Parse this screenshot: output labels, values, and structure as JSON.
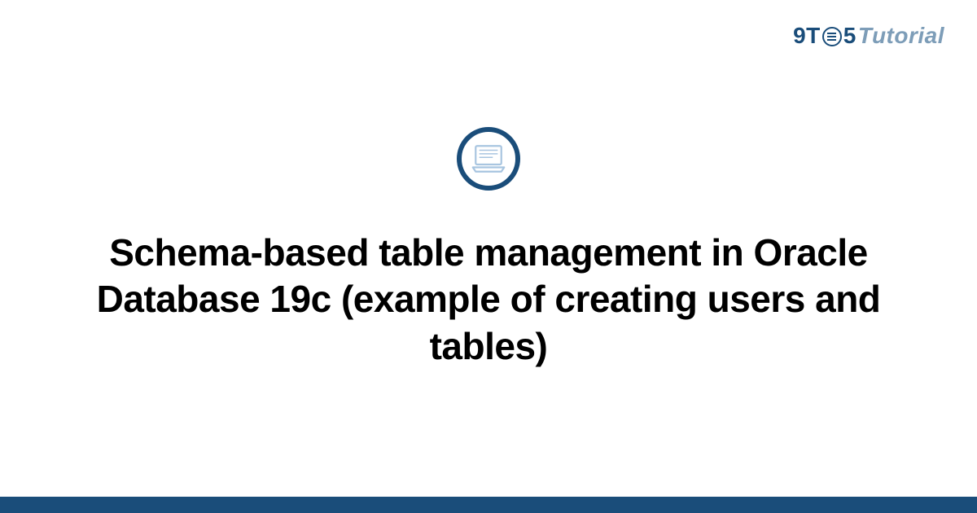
{
  "header": {
    "logo_9t": "9T",
    "logo_5": "5",
    "logo_tutorial": "Tutorial"
  },
  "main": {
    "title": "Schema-based table management in Oracle Database 19c (example of creating users and tables)"
  },
  "colors": {
    "primary": "#1a4d7a",
    "secondary": "#7d9db8",
    "icon_light": "#a8c5e0"
  }
}
